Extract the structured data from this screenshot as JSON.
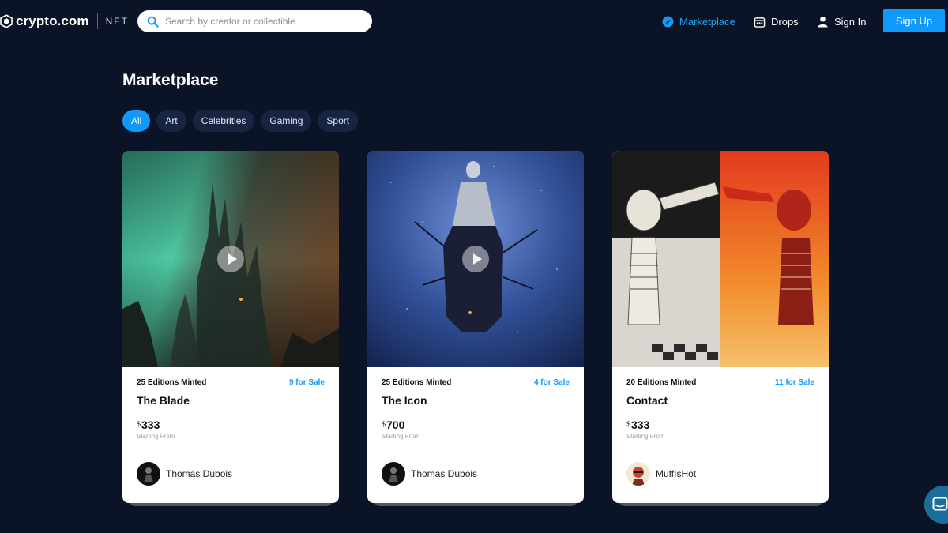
{
  "header": {
    "brand": "crypto.com",
    "brand_suffix": "NFT",
    "search_placeholder": "Search by creator or collectible",
    "nav": {
      "marketplace": "Marketplace",
      "drops": "Drops",
      "sign_in": "Sign In",
      "sign_up": "Sign Up"
    },
    "accent_color": "#1199fa"
  },
  "page": {
    "title": "Marketplace",
    "filters": [
      "All",
      "Art",
      "Celebrities",
      "Gaming",
      "Sport"
    ],
    "active_filter": "All"
  },
  "cards": [
    {
      "editions": "25 Editions Minted",
      "for_sale": "9 for Sale",
      "title": "The Blade",
      "currency": "$",
      "price": "333",
      "price_caption": "Starting From",
      "creator": "Thomas Dubois",
      "media": "video",
      "icon": "play-icon"
    },
    {
      "editions": "25 Editions Minted",
      "for_sale": "4 for Sale",
      "title": "The Icon",
      "currency": "$",
      "price": "700",
      "price_caption": "Starting From",
      "creator": "Thomas Dubois",
      "media": "video",
      "icon": "play-icon"
    },
    {
      "editions": "20 Editions Minted",
      "for_sale": "11 for Sale",
      "title": "Contact",
      "currency": "$",
      "price": "333",
      "price_caption": "Starting From",
      "creator": "MuffIsHot",
      "media": "image"
    }
  ]
}
